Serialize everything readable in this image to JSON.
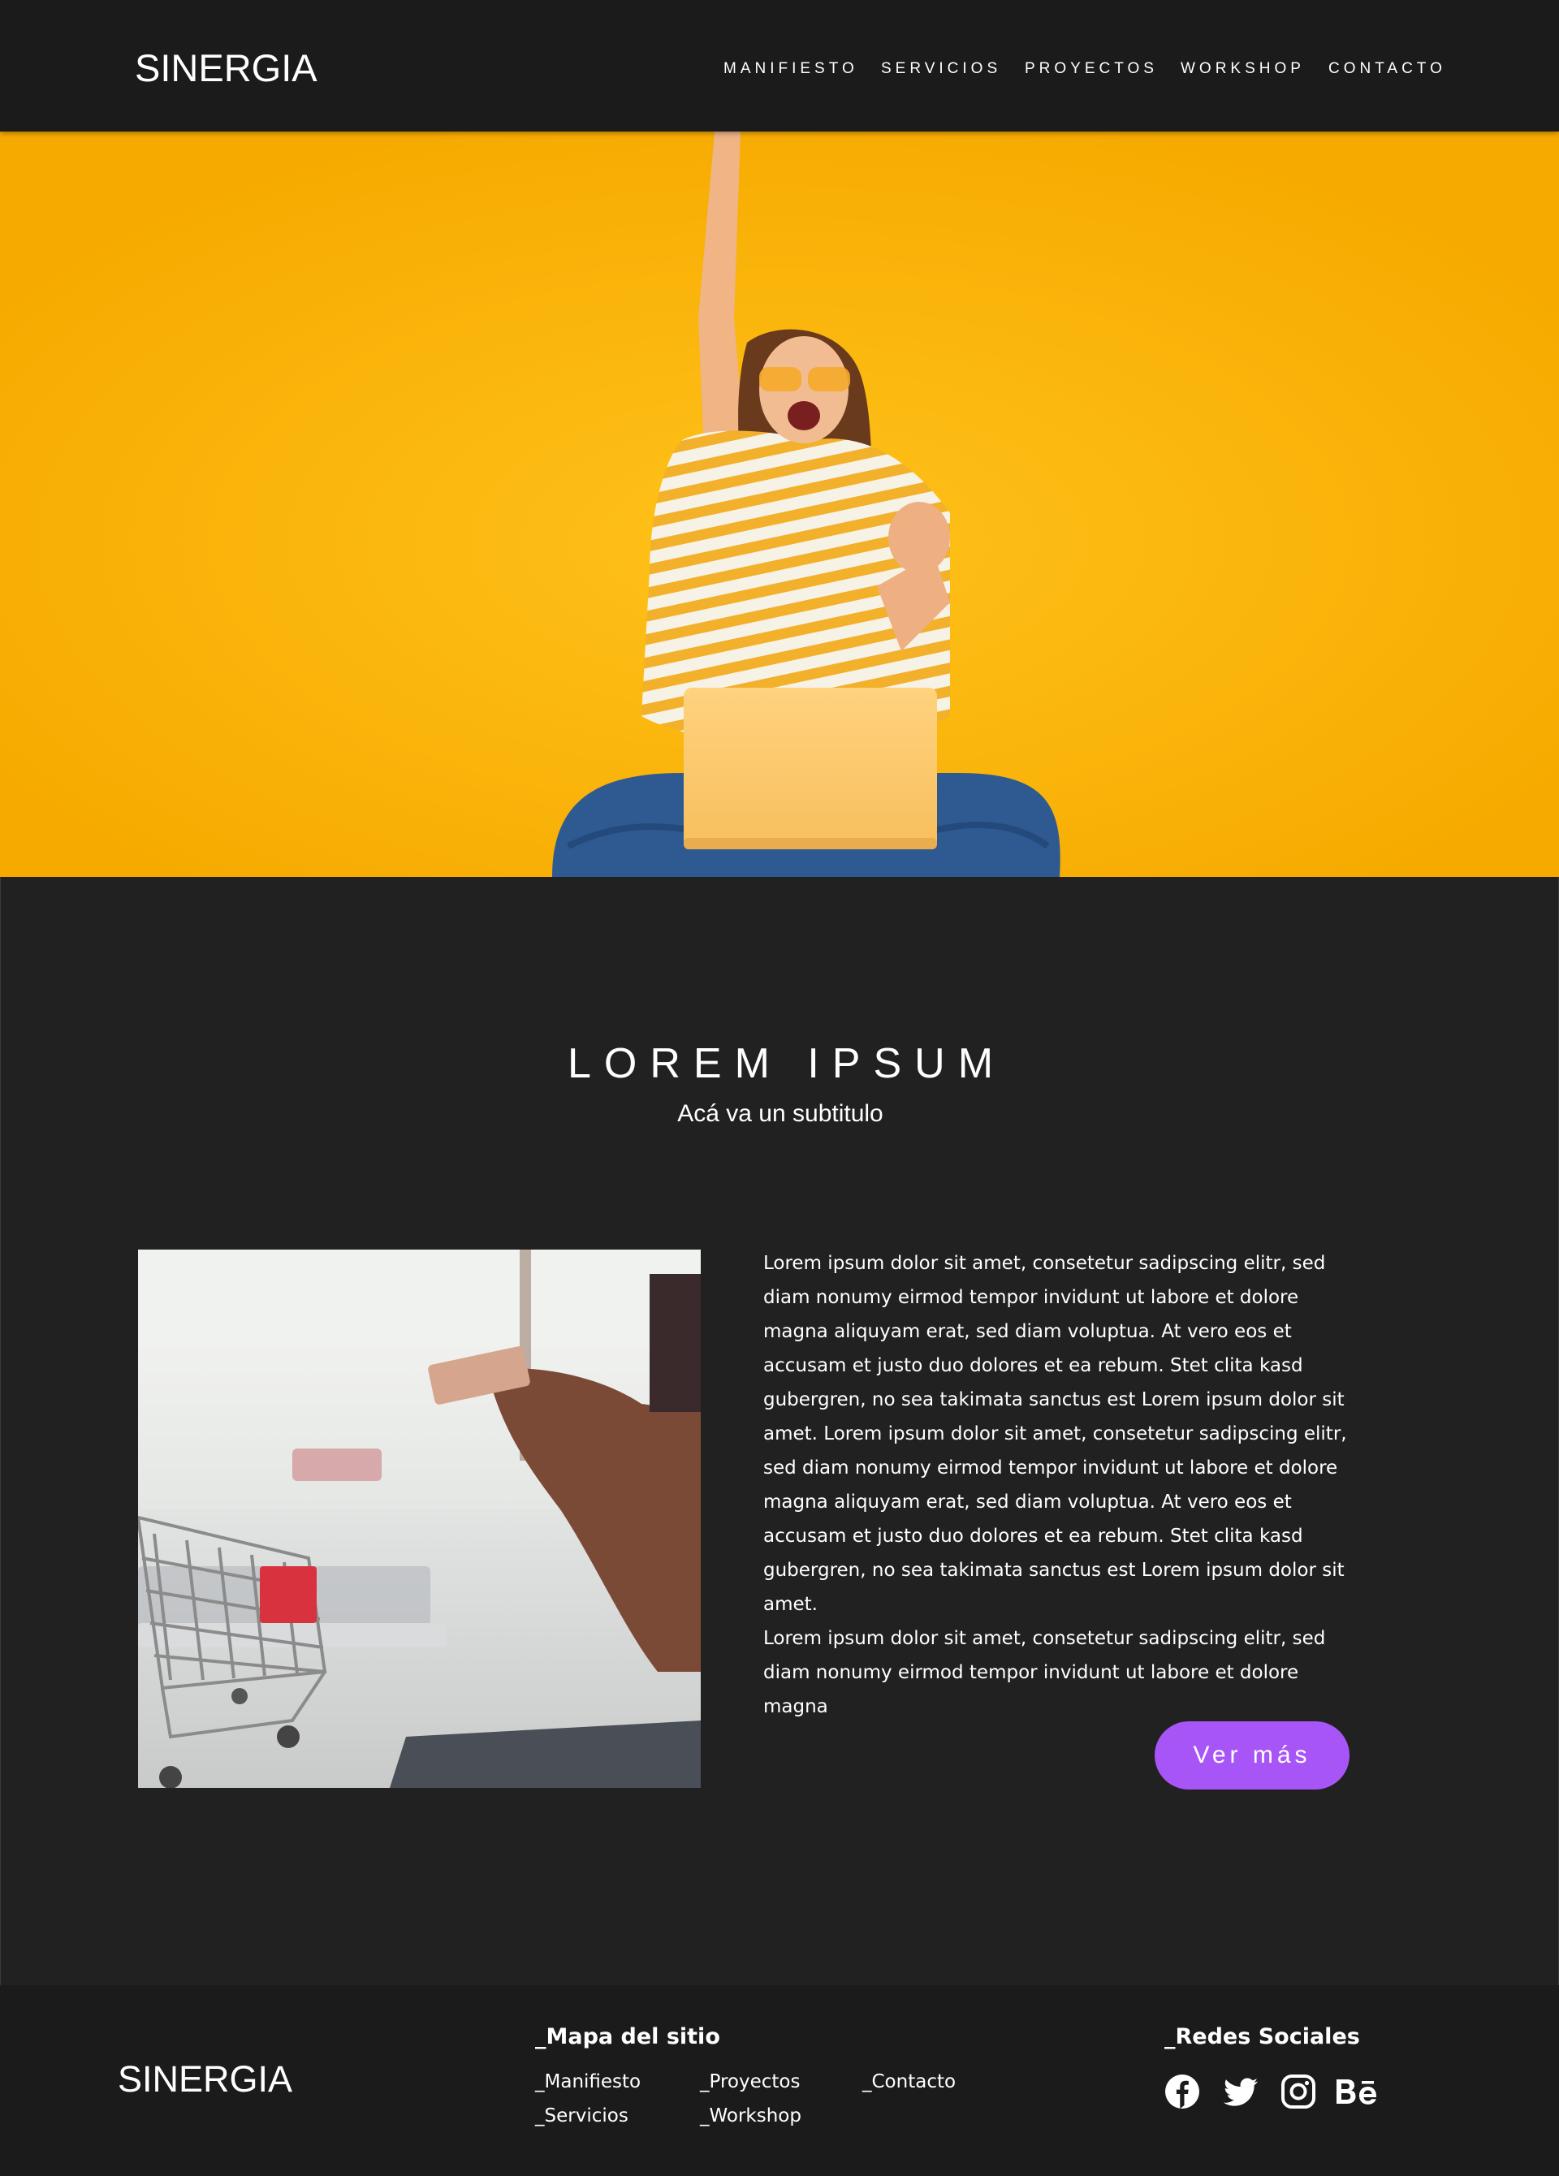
{
  "header": {
    "logo": "SINERGIA",
    "nav": [
      "MANIFIESTO",
      "SERVICIOS",
      "PROYECTOS",
      "WORKSHOP",
      "CONTACTO"
    ]
  },
  "hero": {
    "image": "woman-celebrating-with-laptop"
  },
  "section": {
    "title": "LOREM IPSUM",
    "subtitle": "Acá va un subtitulo",
    "image": "shopping-cart-credit-card-photo",
    "paragraphs": [
      "Lorem ipsum dolor sit amet, consetetur sadipscing elitr, sed diam nonumy eirmod tempor invidunt ut labore et dolore magna aliquyam erat, sed diam voluptua. At vero eos et accusam et justo duo dolores et ea rebum. Stet clita kasd gubergren, no sea takimata sanctus est Lorem ipsum dolor sit amet. Lorem ipsum dolor sit amet, consetetur sadipscing elitr, sed diam nonumy eirmod tempor invidunt ut labore et dolore magna aliquyam erat, sed diam voluptua. At vero eos et accusam et justo duo dolores et ea rebum. Stet clita kasd gubergren, no sea takimata sanctus est Lorem ipsum dolor sit amet.",
      "Lorem ipsum dolor sit amet, consetetur sadipscing elitr, sed diam nonumy eirmod tempor invidunt ut labore et dolore magna"
    ],
    "button_label": "Ver más"
  },
  "footer": {
    "logo": "SINERGIA",
    "sitemap_heading": "_Mapa del sitio",
    "sitemap_links": [
      "_Manifiesto",
      "_Servicios",
      "_Proyectos",
      "_Workshop",
      "_Contacto"
    ],
    "social_heading": "_Redes Sociales",
    "social_icons": [
      "facebook-icon",
      "twitter-icon",
      "instagram-icon",
      "behance-icon"
    ]
  },
  "colors": {
    "header_bg": "#1b1b1b",
    "page_bg": "#212121",
    "hero_yellow": "#fdb707",
    "accent_button": "#a855f7",
    "text": "#ffffff"
  }
}
